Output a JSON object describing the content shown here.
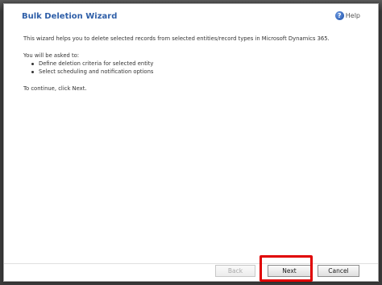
{
  "wizard": {
    "title": "Bulk Deletion Wizard",
    "help_label": "Help",
    "help_icon": "help-icon",
    "intro": "This wizard helps you to delete selected records from selected entities/record types in Microsoft Dynamics 365.",
    "asked_label": "You will be asked to:",
    "steps": [
      "Define deletion criteria for selected entity",
      "Select scheduling and notification options"
    ],
    "continue_text": "To continue, click Next."
  },
  "buttons": {
    "back_label": "Back",
    "next_label": "Next",
    "cancel_label": "Cancel"
  },
  "colors": {
    "title": "#2f5fa8",
    "highlight": "#e00000"
  }
}
